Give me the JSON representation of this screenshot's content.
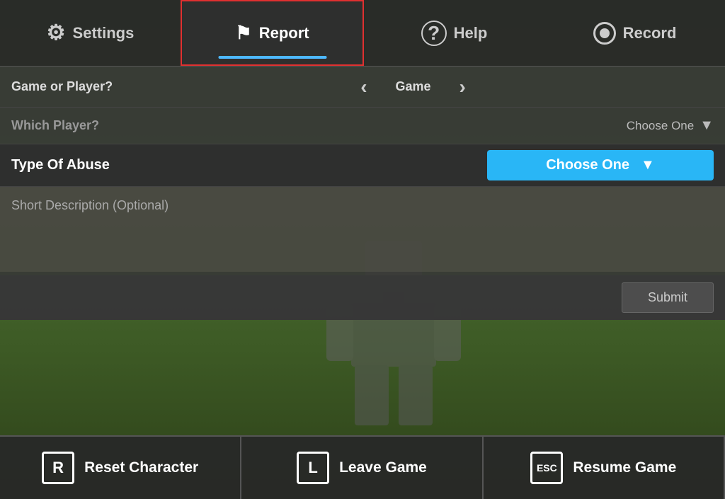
{
  "menu": {
    "settings_label": "Settings",
    "report_label": "Report",
    "help_label": "Help",
    "record_label": "Record"
  },
  "panel": {
    "game_player_label": "Game or Player?",
    "game_player_value": "Game",
    "which_player_label": "Which Player?",
    "which_player_placeholder": "Choose One",
    "abuse_label": "Type Of Abuse",
    "abuse_dropdown_label": "Choose One",
    "description_placeholder": "Short Description (Optional)",
    "submit_label": "Submit"
  },
  "bottom_bar": {
    "reset_key": "R",
    "reset_label": "Reset Character",
    "leave_key": "L",
    "leave_label": "Leave Game",
    "resume_key": "ESC",
    "resume_label": "Resume Game"
  }
}
